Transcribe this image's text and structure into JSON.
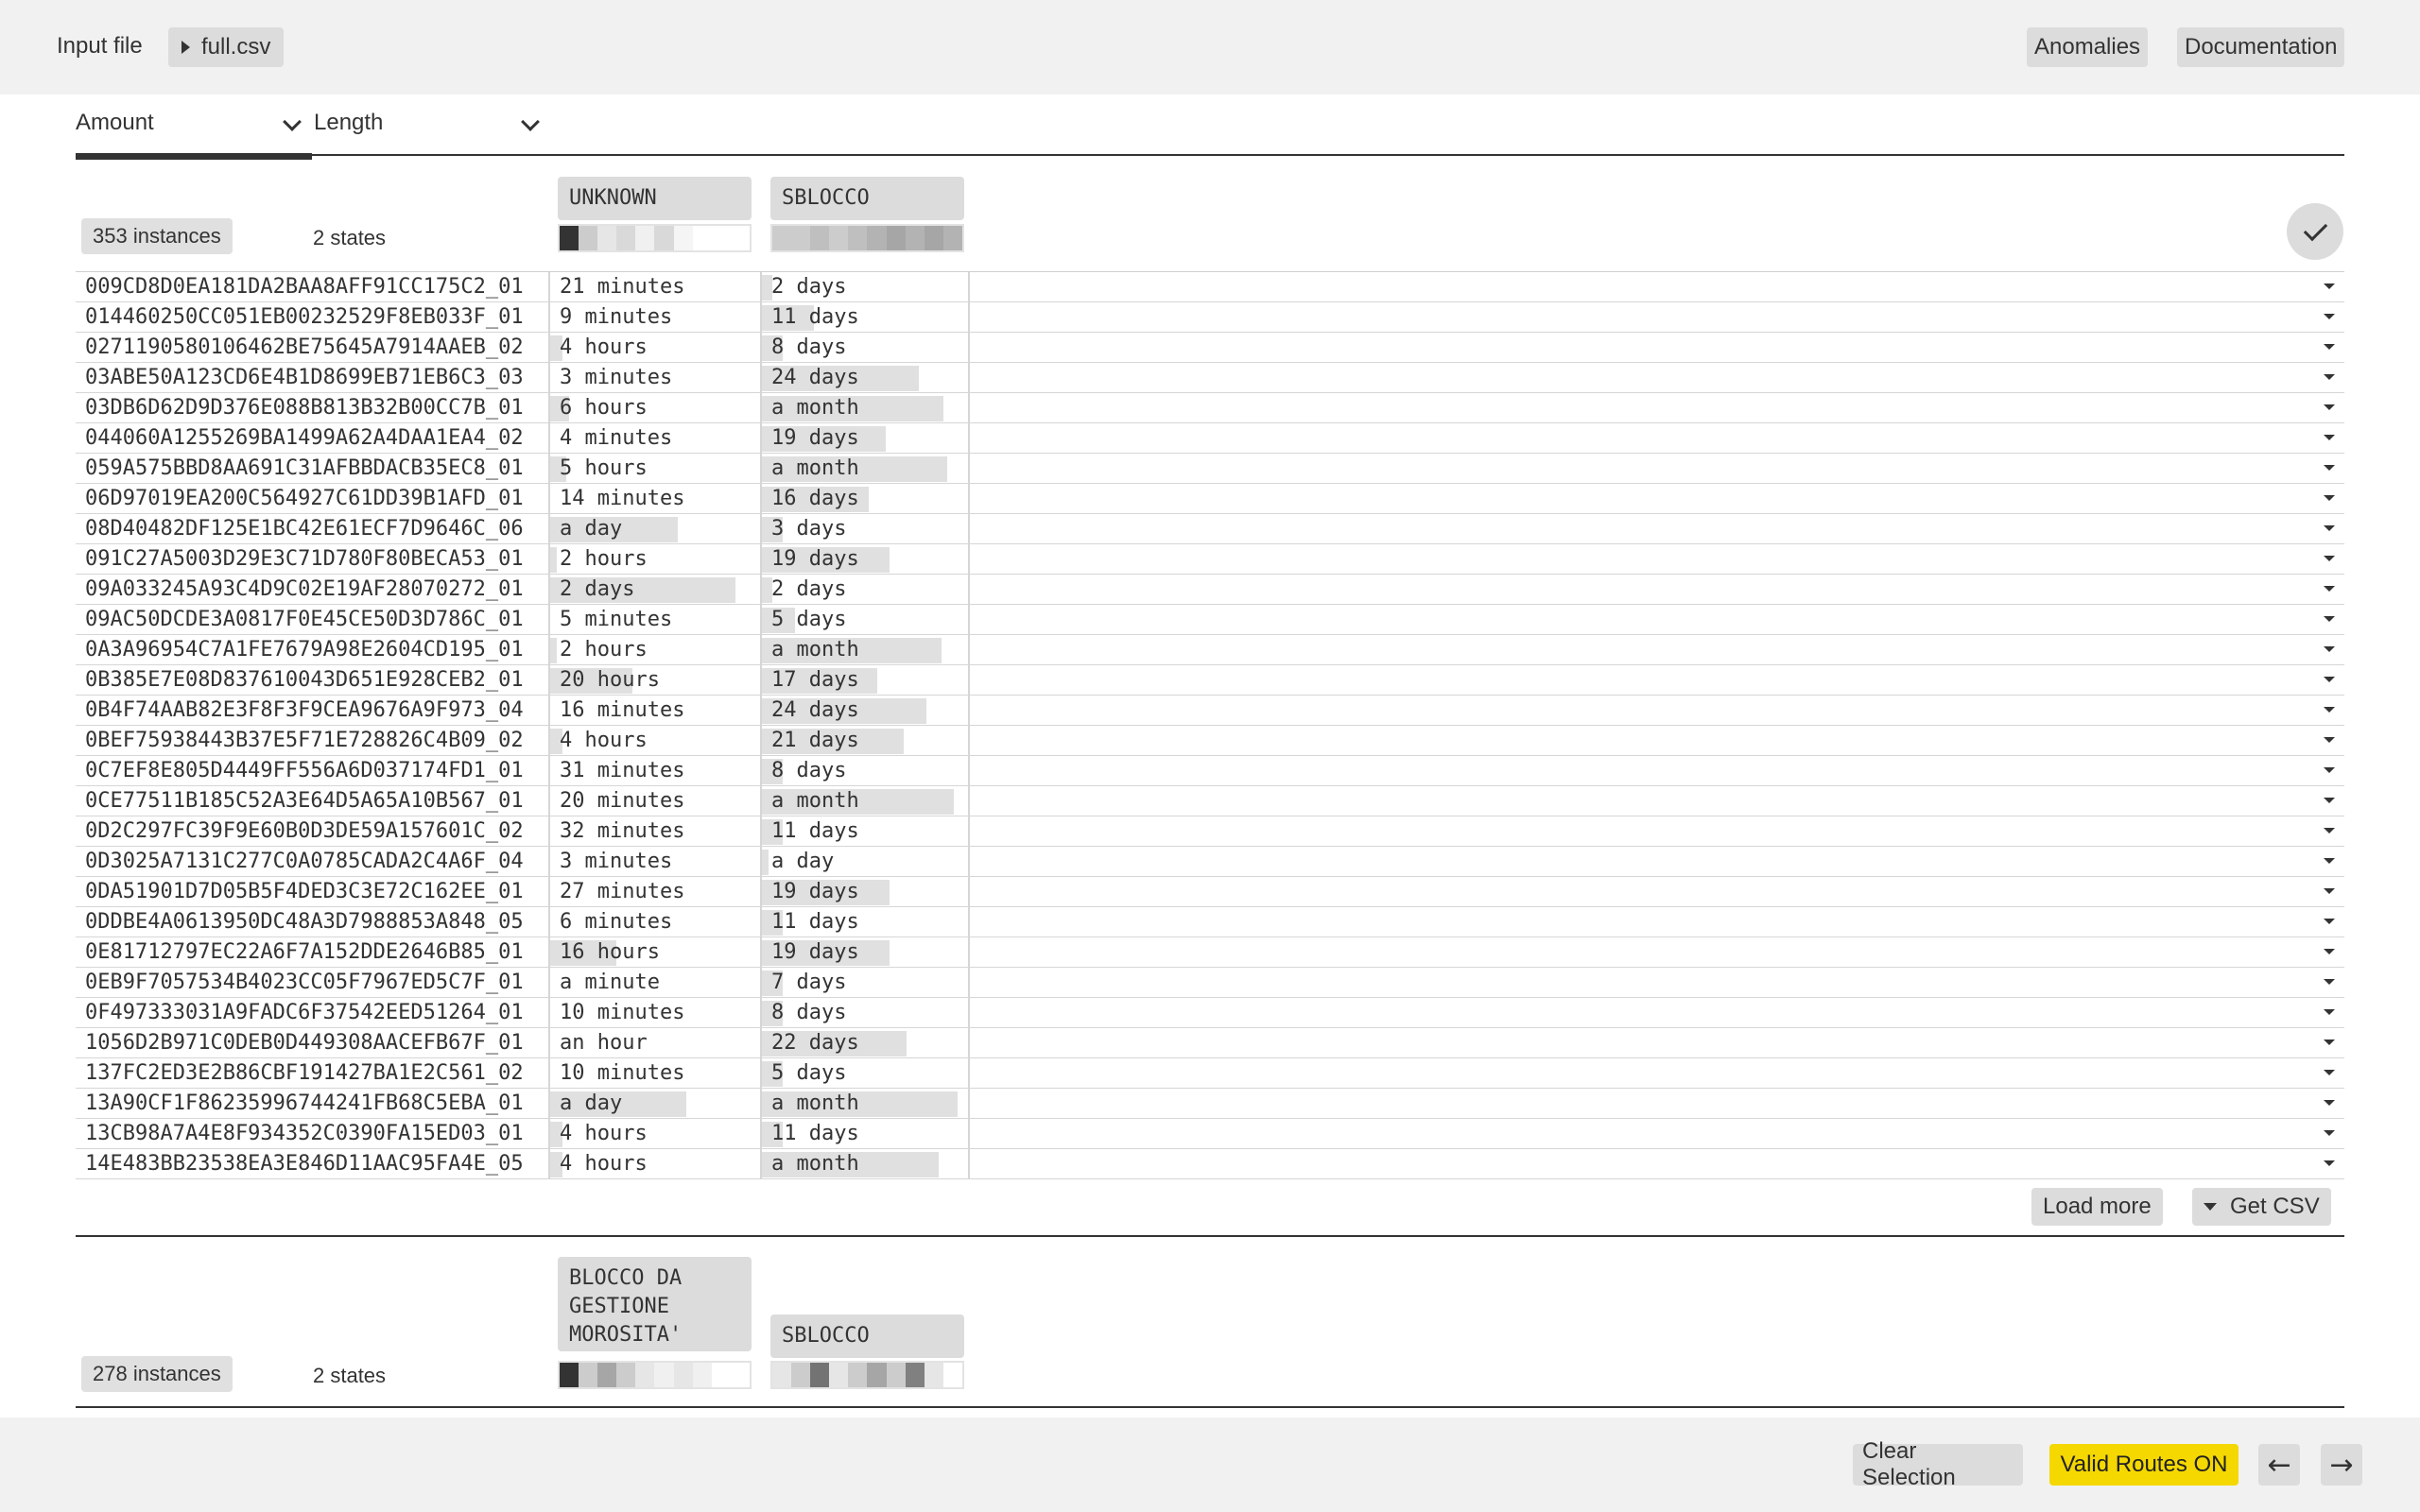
{
  "header": {
    "input_label": "Input file",
    "file_name": "full.csv",
    "anomalies": "Anomalies",
    "documentation": "Documentation"
  },
  "tabs": [
    {
      "label": "Amount",
      "active": true
    },
    {
      "label": "Length",
      "active": false
    }
  ],
  "groups": [
    {
      "instances": "353 instances",
      "states": "2 states",
      "columns": [
        {
          "name": "UNKNOWN",
          "swatches": [
            "#333333",
            "#cccccc",
            "#e6e6e6",
            "#d9d9d9",
            "#f0f0f0",
            "#d9d9d9",
            "#f5f5f5",
            "#ffffff",
            "#ffffff",
            "#ffffff"
          ]
        },
        {
          "name": "SBLOCCO",
          "swatches": [
            "#cccccc",
            "#cccccc",
            "#bfbfbf",
            "#cccccc",
            "#bfbfbf",
            "#b3b3b3",
            "#a6a6a6",
            "#b3b3b3",
            "#a6a6a6",
            "#b3b3b3"
          ]
        }
      ],
      "rows": [
        {
          "id": "009CD8D0EA181DA2BAA8AFF91CC175C2_01",
          "a": "21 minutes",
          "a_frac": 0.0,
          "b": "2 days",
          "b_frac": 0.05
        },
        {
          "id": "014460250CC051EB00232529F8EB033F_01",
          "a": "9 minutes",
          "a_frac": 0.0,
          "b": "11 days",
          "b_frac": 0.25
        },
        {
          "id": "0271190580106462BE75645A7914AAEB_02",
          "a": "4 hours",
          "a_frac": 0.06,
          "b": "8 days",
          "b_frac": 0.1
        },
        {
          "id": "03ABE50A123CD6E4B1D8699EB71EB6C3_03",
          "a": "3 minutes",
          "a_frac": 0.0,
          "b": "24 days",
          "b_frac": 0.76
        },
        {
          "id": "03DB6D62D9D376E088B813B32B00CC7B_01",
          "a": "6 hours",
          "a_frac": 0.09,
          "b": "a month",
          "b_frac": 0.88
        },
        {
          "id": "044060A1255269BA1499A62A4DAA1EA4_02",
          "a": "4 minutes",
          "a_frac": 0.0,
          "b": "19 days",
          "b_frac": 0.6
        },
        {
          "id": "059A575BBD8AA691C31AFBBDACB35EC8_01",
          "a": "5 hours",
          "a_frac": 0.08,
          "b": "a month",
          "b_frac": 0.9
        },
        {
          "id": "06D97019EA200C564927C61DD39B1AFD_01",
          "a": "14 minutes",
          "a_frac": 0.0,
          "b": "16 days",
          "b_frac": 0.52
        },
        {
          "id": "08D40482DF125E1BC42E61ECF7D9646C_06",
          "a": "a day",
          "a_frac": 0.62,
          "b": "3 days",
          "b_frac": 0.1
        },
        {
          "id": "091C27A5003D29E3C71D780F80BECA53_01",
          "a": "2 hours",
          "a_frac": 0.03,
          "b": "19 days",
          "b_frac": 0.62
        },
        {
          "id": "09A033245A93C4D9C02E19AF28070272_01",
          "a": "2 days",
          "a_frac": 0.9,
          "b": "2 days",
          "b_frac": 0.05
        },
        {
          "id": "09AC50DCDE3A0817F0E45CE50D3D786C_01",
          "a": "5 minutes",
          "a_frac": 0.0,
          "b": "5 days",
          "b_frac": 0.16
        },
        {
          "id": "0A3A96954C7A1FE7679A98E2604CD195_01",
          "a": "2 hours",
          "a_frac": 0.03,
          "b": "a month",
          "b_frac": 0.87
        },
        {
          "id": "0B385E7E08D837610043D651E928CEB2_01",
          "a": "20 hours",
          "a_frac": 0.4,
          "b": "17 days",
          "b_frac": 0.56
        },
        {
          "id": "0B4F74AAB82E3F8F3F9CEA9676A9F973_04",
          "a": "16 minutes",
          "a_frac": 0.0,
          "b": "24 days",
          "b_frac": 0.8
        },
        {
          "id": "0BEF75938443B37E5F71E728826C4B09_02",
          "a": "4 hours",
          "a_frac": 0.06,
          "b": "21 days",
          "b_frac": 0.69
        },
        {
          "id": "0C7EF8E805D4449FF556A6D037174FD1_01",
          "a": "31 minutes",
          "a_frac": 0.0,
          "b": "8 days",
          "b_frac": 0.1
        },
        {
          "id": "0CE77511B185C52A3E64D5A65A10B567_01",
          "a": "20 minutes",
          "a_frac": 0.0,
          "b": "a month",
          "b_frac": 0.93
        },
        {
          "id": "0D2C297FC39F9E60B0D3DE59A157601C_02",
          "a": "32 minutes",
          "a_frac": 0.0,
          "b": "11 days",
          "b_frac": 0.1
        },
        {
          "id": "0D3025A7131C277C0A0785CADA2C4A6F_04",
          "a": "3 minutes",
          "a_frac": 0.0,
          "b": "a day",
          "b_frac": 0.03
        },
        {
          "id": "0DA51901D7D05B5F4DED3C3E72C162EE_01",
          "a": "27 minutes",
          "a_frac": 0.0,
          "b": "19 days",
          "b_frac": 0.62
        },
        {
          "id": "0DDBE4A0613950DC48A3D7988853A848_05",
          "a": "6 minutes",
          "a_frac": 0.0,
          "b": "11 days",
          "b_frac": 0.1
        },
        {
          "id": "0E81712797EC22A6F7A152DDE2646B85_01",
          "a": "16 hours",
          "a_frac": 0.32,
          "b": "19 days",
          "b_frac": 0.62
        },
        {
          "id": "0EB9F7057534B4023CC05F7967ED5C7F_01",
          "a": "a minute",
          "a_frac": 0.0,
          "b": "7 days",
          "b_frac": 0.1
        },
        {
          "id": "0F497333031A9FADC6F37542EED51264_01",
          "a": "10 minutes",
          "a_frac": 0.0,
          "b": "8 days",
          "b_frac": 0.1
        },
        {
          "id": "1056D2B971C0DEB0D449308AACEFB67F_01",
          "a": "an hour",
          "a_frac": 0.0,
          "b": "22 days",
          "b_frac": 0.7
        },
        {
          "id": "137FC2ED3E2B86CBF191427BA1E2C561_02",
          "a": "10 minutes",
          "a_frac": 0.0,
          "b": "5 days",
          "b_frac": 0.1
        },
        {
          "id": "13A90CF1F86235996744241FB68C5EBA_01",
          "a": "a day",
          "a_frac": 0.66,
          "b": "a month",
          "b_frac": 0.95
        },
        {
          "id": "13CB98A7A4E8F934352C0390FA15ED03_01",
          "a": "4 hours",
          "a_frac": 0.06,
          "b": "11 days",
          "b_frac": 0.1
        },
        {
          "id": "14E483BB23538EA3E846D11AAC95FA4E_05",
          "a": "4 hours",
          "a_frac": 0.06,
          "b": "a month",
          "b_frac": 0.86
        }
      ],
      "load_more": "Load more",
      "get_csv": "Get CSV"
    },
    {
      "instances": "278 instances",
      "states": "2 states",
      "columns": [
        {
          "name": "BLOCCO DA GESTIONE MOROSITA'",
          "swatches": [
            "#333333",
            "#cccccc",
            "#a6a6a6",
            "#cccccc",
            "#e6e6e6",
            "#f0f0f0",
            "#e6e6e6",
            "#f0f0f0",
            "#ffffff",
            "#ffffff"
          ]
        },
        {
          "name": "SBLOCCO",
          "swatches": [
            "#e6e6e6",
            "#cccccc",
            "#737373",
            "#e6e6e6",
            "#cccccc",
            "#a6a6a6",
            "#cccccc",
            "#808080",
            "#e6e6e6",
            "#ffffff"
          ]
        }
      ]
    }
  ],
  "footer": {
    "clear_selection": "Clear Selection",
    "valid_routes": "Valid Routes ON",
    "prev_icon": "arrow-left-icon",
    "next_icon": "arrow-right-icon",
    "prev_glyph": "←",
    "next_glyph": "→",
    "accent": "#f5d800"
  }
}
